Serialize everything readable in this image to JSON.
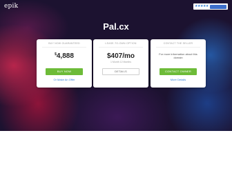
{
  "brand": {
    "logo_text": "epik"
  },
  "trust_badge": {
    "stars": "★★★★★",
    "label": ""
  },
  "domain": {
    "name": "Pal.cx"
  },
  "cards": [
    {
      "heading": "BUY NOW GUARANTEED",
      "currency": "$",
      "price": "4,888",
      "button_label": "BUY NOW",
      "link_label": "Or Make An Offer"
    },
    {
      "heading": "LEASE-TO-OWN OPTION",
      "price": "$407/mo",
      "subtext": "1 Month 12 Months",
      "button_label": "DETAILS"
    },
    {
      "heading": "CONTACT THE SELLER",
      "info_text": "For more information about this domain",
      "button_label": "CONTACT OWNER",
      "link_label": "More Details"
    }
  ],
  "colors": {
    "background_dark": "#1c1230",
    "accent_green": "#6dbb38",
    "link_blue": "#2e7cd6",
    "nebula_red": "#d22850",
    "nebula_blue": "#286ec8"
  }
}
